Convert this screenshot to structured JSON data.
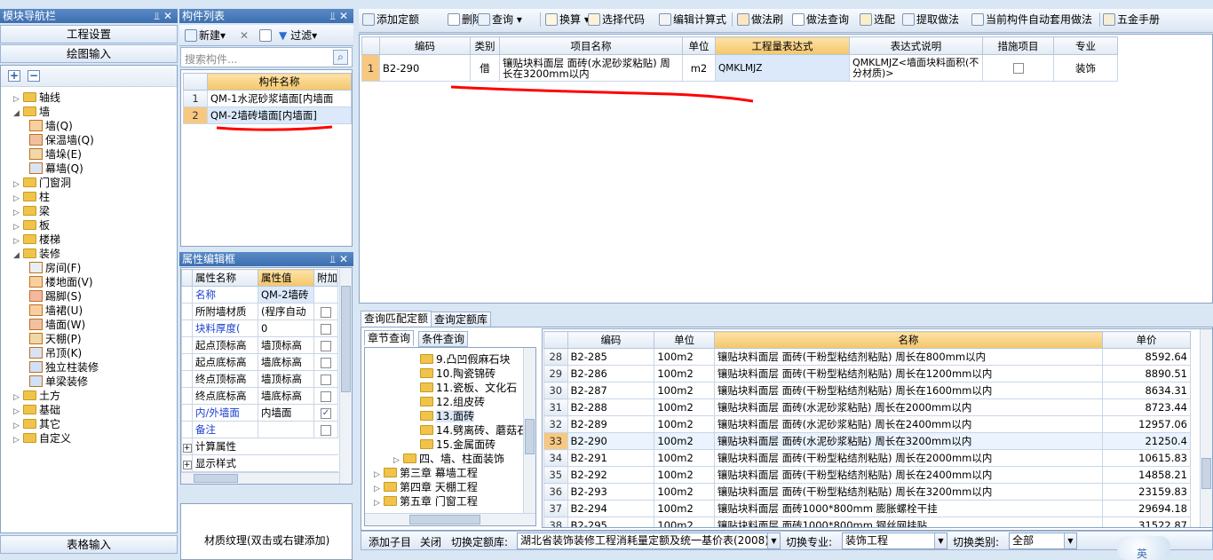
{
  "nav": {
    "title": "模块导航栏",
    "btn_project": "工程设置",
    "btn_draw": "绘图输入",
    "btn_table": "表格输入",
    "tree": [
      {
        "label": "轴线",
        "level": 0,
        "exp": "▷"
      },
      {
        "label": "墙",
        "level": 0,
        "exp": "◢"
      },
      {
        "label": "墙(Q)",
        "level": 1,
        "exp": ""
      },
      {
        "label": "保温墙(Q)",
        "level": 1,
        "exp": ""
      },
      {
        "label": "墙垛(E)",
        "level": 1,
        "exp": ""
      },
      {
        "label": "幕墙(Q)",
        "level": 1,
        "exp": ""
      },
      {
        "label": "门窗洞",
        "level": 0,
        "exp": "▷"
      },
      {
        "label": "柱",
        "level": 0,
        "exp": "▷"
      },
      {
        "label": "梁",
        "level": 0,
        "exp": "▷"
      },
      {
        "label": "板",
        "level": 0,
        "exp": "▷"
      },
      {
        "label": "楼梯",
        "level": 0,
        "exp": "▷"
      },
      {
        "label": "装修",
        "level": 0,
        "exp": "◢"
      },
      {
        "label": "房间(F)",
        "level": 1,
        "exp": ""
      },
      {
        "label": "楼地面(V)",
        "level": 1,
        "exp": ""
      },
      {
        "label": "踢脚(S)",
        "level": 1,
        "exp": ""
      },
      {
        "label": "墙裙(U)",
        "level": 1,
        "exp": ""
      },
      {
        "label": "墙面(W)",
        "level": 1,
        "exp": ""
      },
      {
        "label": "天棚(P)",
        "level": 1,
        "exp": ""
      },
      {
        "label": "吊顶(K)",
        "level": 1,
        "exp": ""
      },
      {
        "label": "独立柱装修",
        "level": 1,
        "exp": ""
      },
      {
        "label": "单梁装修",
        "level": 1,
        "exp": ""
      },
      {
        "label": "土方",
        "level": 0,
        "exp": "▷"
      },
      {
        "label": "基础",
        "level": 0,
        "exp": "▷"
      },
      {
        "label": "其它",
        "level": 0,
        "exp": "▷"
      },
      {
        "label": "自定义",
        "level": 0,
        "exp": "▷"
      }
    ]
  },
  "comp": {
    "title": "构件列表",
    "new_label": "新建",
    "filter_label": "过滤",
    "search_placeholder": "搜索构件...",
    "col_name": "构件名称",
    "rows": [
      {
        "n": "1",
        "name": "QM-1水泥砂浆墙面[内墙面"
      },
      {
        "n": "2",
        "name": "QM-2墙砖墙面[内墙面]"
      }
    ]
  },
  "props": {
    "title": "属性编辑框",
    "col_name": "属性名称",
    "col_value": "属性值",
    "col_extra": "附加",
    "rows": [
      {
        "name": "名称",
        "value": "QM-2墙砖",
        "blue": true,
        "chk": false
      },
      {
        "name": "所附墙材质",
        "value": "(程序自动",
        "blue": false,
        "chk": true
      },
      {
        "name": "块料厚度(",
        "value": "0",
        "blue": true,
        "chk": true
      },
      {
        "name": "起点顶标高",
        "value": "墙顶标高",
        "blue": false,
        "chk": true
      },
      {
        "name": "起点底标高",
        "value": "墙底标高",
        "blue": false,
        "chk": true
      },
      {
        "name": "终点顶标高",
        "value": "墙顶标高",
        "blue": false,
        "chk": true
      },
      {
        "name": "终点底标高",
        "value": "墙底标高",
        "blue": false,
        "chk": true
      },
      {
        "name": "内/外墙面",
        "value": "内墙面",
        "blue": true,
        "chk": true
      },
      {
        "name": "备注",
        "value": "",
        "blue": true,
        "chk": true
      },
      {
        "name": "计算属性",
        "value": "",
        "blue": false,
        "chk": false
      },
      {
        "name": "显示样式",
        "value": "",
        "blue": false,
        "chk": false
      }
    ],
    "texture_label": "材质纹理(双击或右键添加)"
  },
  "toolbar": {
    "items": [
      "添加定额",
      "删除",
      "查询",
      "换算",
      "选择代码",
      "编辑计算式",
      "做法刷",
      "做法查询",
      "选配",
      "提取做法",
      "当前构件自动套用做法",
      "五金手册"
    ]
  },
  "quota": {
    "headers": [
      "编码",
      "类别",
      "项目名称",
      "单位",
      "工程量表达式",
      "表达式说明",
      "措施项目",
      "专业"
    ],
    "row": {
      "n": "1",
      "code": "B2-290",
      "type": "借",
      "name": "镶贴块料面层 面砖(水泥砂浆粘贴) 周长在3200mm以内",
      "unit": "m2",
      "expr": "QMKLMJZ",
      "desc": "QMKLMJZ<墙面块料面积(不分材质)>",
      "major": "装饰"
    }
  },
  "lower": {
    "tab_match": "查询匹配定额",
    "tab_lib": "查询定额库",
    "tab_chapter": "章节查询",
    "tab_cond": "条件查询",
    "chapters": [
      {
        "label": "9.凸凹假麻石块",
        "level": 2
      },
      {
        "label": "10.陶瓷锦砖",
        "level": 2
      },
      {
        "label": "11.瓷板、文化石",
        "level": 2
      },
      {
        "label": "12.组皮砖",
        "level": 2
      },
      {
        "label": "13.面砖",
        "level": 2
      },
      {
        "label": "14.劈离砖、蘑菇石",
        "level": 2
      },
      {
        "label": "15.金属面砖",
        "level": 2
      },
      {
        "label": "四、墙、柱面装饰",
        "level": 1
      },
      {
        "label": "第三章 幕墙工程",
        "level": 0
      },
      {
        "label": "第四章 天棚工程",
        "level": 0
      },
      {
        "label": "第五章 门窗工程",
        "level": 0
      }
    ],
    "headers": [
      "编码",
      "单位",
      "名称",
      "单价"
    ],
    "rows": [
      {
        "n": "28",
        "code": "B2-285",
        "unit": "100m2",
        "name": "镶贴块料面层 面砖(干粉型粘结剂粘贴) 周长在800mm以内",
        "price": "8592.64"
      },
      {
        "n": "29",
        "code": "B2-286",
        "unit": "100m2",
        "name": "镶贴块料面层 面砖(干粉型粘结剂粘贴) 周长在1200mm以内",
        "price": "8890.51"
      },
      {
        "n": "30",
        "code": "B2-287",
        "unit": "100m2",
        "name": "镶贴块料面层 面砖(干粉型粘结剂粘贴) 周长在1600mm以内",
        "price": "8634.31"
      },
      {
        "n": "31",
        "code": "B2-288",
        "unit": "100m2",
        "name": "镶贴块料面层 面砖(水泥砂浆粘贴) 周长在2000mm以内",
        "price": "8723.44"
      },
      {
        "n": "32",
        "code": "B2-289",
        "unit": "100m2",
        "name": "镶贴块料面层 面砖(水泥砂浆粘贴) 周长在2400mm以内",
        "price": "12957.06"
      },
      {
        "n": "33",
        "code": "B2-290",
        "unit": "100m2",
        "name": "镶贴块料面层 面砖(水泥砂浆粘贴) 周长在3200mm以内",
        "price": "21250.4"
      },
      {
        "n": "34",
        "code": "B2-291",
        "unit": "100m2",
        "name": "镶贴块料面层 面砖(干粉型粘结剂粘贴) 周长在2000mm以内",
        "price": "10615.83"
      },
      {
        "n": "35",
        "code": "B2-292",
        "unit": "100m2",
        "name": "镶贴块料面层 面砖(干粉型粘结剂粘贴) 周长在2400mm以内",
        "price": "14858.21"
      },
      {
        "n": "36",
        "code": "B2-293",
        "unit": "100m2",
        "name": "镶贴块料面层 面砖(干粉型粘结剂粘贴) 周长在3200mm以内",
        "price": "23159.83"
      },
      {
        "n": "37",
        "code": "B2-294",
        "unit": "100m2",
        "name": "镶贴块料面层 面砖1000*800mm 膨胀螺栓干挂",
        "price": "29694.18"
      },
      {
        "n": "38",
        "code": "B2-295",
        "unit": "100m2",
        "name": "镶贴块料面层 面砖1000*800mm 钢丝网挂贴",
        "price": "31522.87"
      }
    ],
    "bottom": {
      "add_sub": "添加子目",
      "close": "关闭",
      "switch_lib_label": "切换定额库:",
      "lib_value": "湖北省装饰装修工程消耗量定额及统一基价表(2008)",
      "switch_major_label": "切换专业:",
      "major_value": "装饰工程",
      "switch_type_label": "切换类别:",
      "type_value": "全部"
    }
  },
  "ime": "英"
}
